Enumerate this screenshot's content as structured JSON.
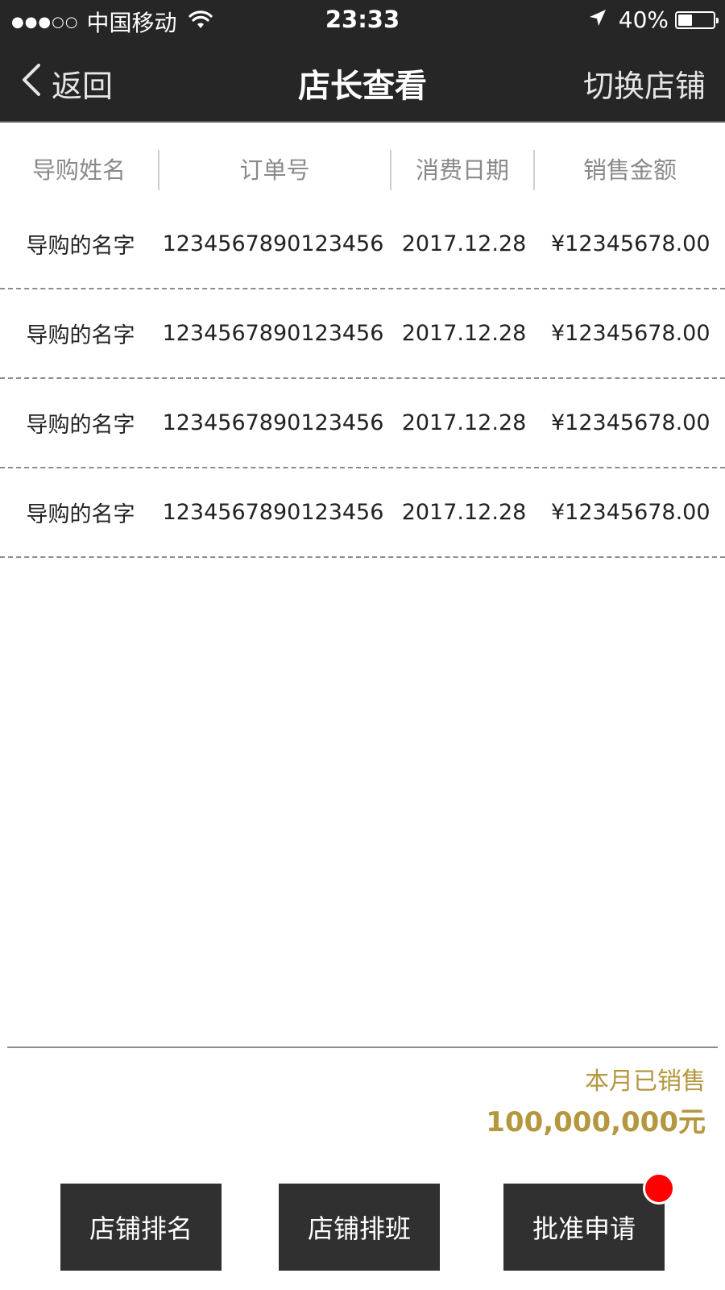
{
  "status_bar": {
    "signal": "●●●○○",
    "carrier": "中国移动",
    "time": "23:33",
    "battery_percent": "40%",
    "battery_level": 0.4
  },
  "navbar": {
    "back_label": "返回",
    "title": "店长查看",
    "switch_label": "切换店铺",
    "background": "#262626"
  },
  "table": {
    "headers": [
      "导购姓名",
      "订单号",
      "消费日期",
      "销售金额"
    ],
    "rows": [
      [
        "导购的名字",
        "1234567890123456",
        "2017.12.28",
        "¥12345678.00"
      ],
      [
        "导购的名字",
        "1234567890123456",
        "2017.12.28",
        "¥12345678.00"
      ],
      [
        "导购的名字",
        "1234567890123456",
        "2017.12.28",
        "¥12345678.00"
      ],
      [
        "导购的名字",
        "1234567890123456",
        "2017.12.28",
        "¥12345678.00"
      ]
    ]
  },
  "summary": {
    "label": "本月已销售",
    "value": "100,000,000元",
    "accent_color": "#b4973f"
  },
  "actions": {
    "store_ranking": "店铺排名",
    "store_schedule": "店铺排班",
    "approve_request": "批准申请",
    "badge_color": "#ff0000"
  },
  "icons": {
    "back": "chevron-left-icon",
    "wifi": "wifi-icon",
    "location": "location-arrow-icon",
    "battery": "battery-icon"
  }
}
